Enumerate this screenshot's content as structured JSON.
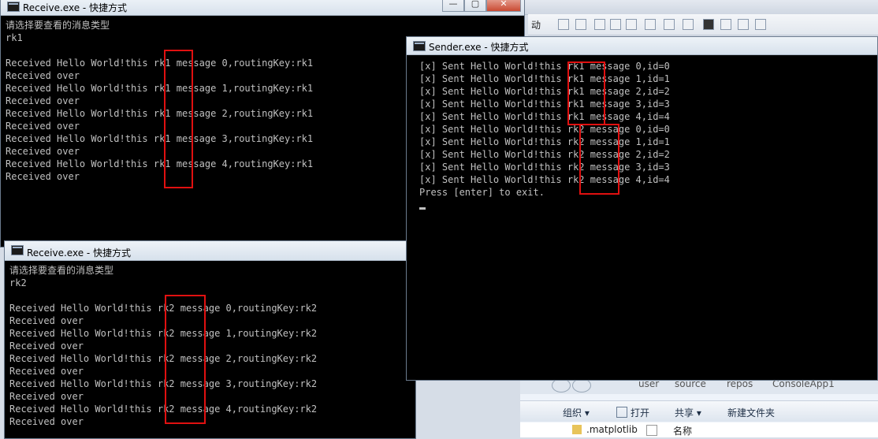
{
  "background_window": {
    "toolbar_partial_label": "动",
    "explorer": {
      "address_parts": [
        "user",
        "source",
        "repos",
        "ConsoleApp1"
      ],
      "commands": [
        "组织 ▾",
        "打开",
        "共享 ▾",
        "新建文件夹"
      ],
      "file_item": ".matplotlib",
      "column_header": "名称"
    }
  },
  "receive_rk1": {
    "title": "Receive.exe - 快捷方式",
    "lines": [
      "请选择要查看的消息类型",
      "rk1",
      "",
      "Received Hello World!this rk1 message 0,routingKey:rk1",
      "Received over",
      "Received Hello World!this rk1 message 1,routingKey:rk1",
      "Received over",
      "Received Hello World!this rk1 message 2,routingKey:rk1",
      "Received over",
      "Received Hello World!this rk1 message 3,routingKey:rk1",
      "Received over",
      "Received Hello World!this rk1 message 4,routingKey:rk1",
      "Received over"
    ]
  },
  "receive_rk2": {
    "title": "Receive.exe - 快捷方式",
    "lines": [
      "请选择要查看的消息类型",
      "rk2",
      "",
      "Received Hello World!this rk2 message 0,routingKey:rk2",
      "Received over",
      "Received Hello World!this rk2 message 1,routingKey:rk2",
      "Received over",
      "Received Hello World!this rk2 message 2,routingKey:rk2",
      "Received over",
      "Received Hello World!this rk2 message 3,routingKey:rk2",
      "Received over",
      "Received Hello World!this rk2 message 4,routingKey:rk2",
      "Received over"
    ]
  },
  "sender": {
    "title": "Sender.exe - 快捷方式",
    "lines": [
      "[x] Sent Hello World!this rk1 message 0,id=0",
      "[x] Sent Hello World!this rk1 message 1,id=1",
      "[x] Sent Hello World!this rk1 message 2,id=2",
      "[x] Sent Hello World!this rk1 message 3,id=3",
      "[x] Sent Hello World!this rk1 message 4,id=4",
      "[x] Sent Hello World!this rk2 message 0,id=0",
      "[x] Sent Hello World!this rk2 message 1,id=1",
      "[x] Sent Hello World!this rk2 message 2,id=2",
      "[x] Sent Hello World!this rk2 message 3,id=3",
      "[x] Sent Hello World!this rk2 message 4,id=4",
      "Press [enter] to exit."
    ]
  },
  "window_controls": {
    "minimize": "—",
    "maximize": "▢",
    "close": "✕"
  },
  "colors": {
    "console_bg": "#000000",
    "console_text": "#c0c0c0",
    "highlight_box": "#e01010"
  }
}
